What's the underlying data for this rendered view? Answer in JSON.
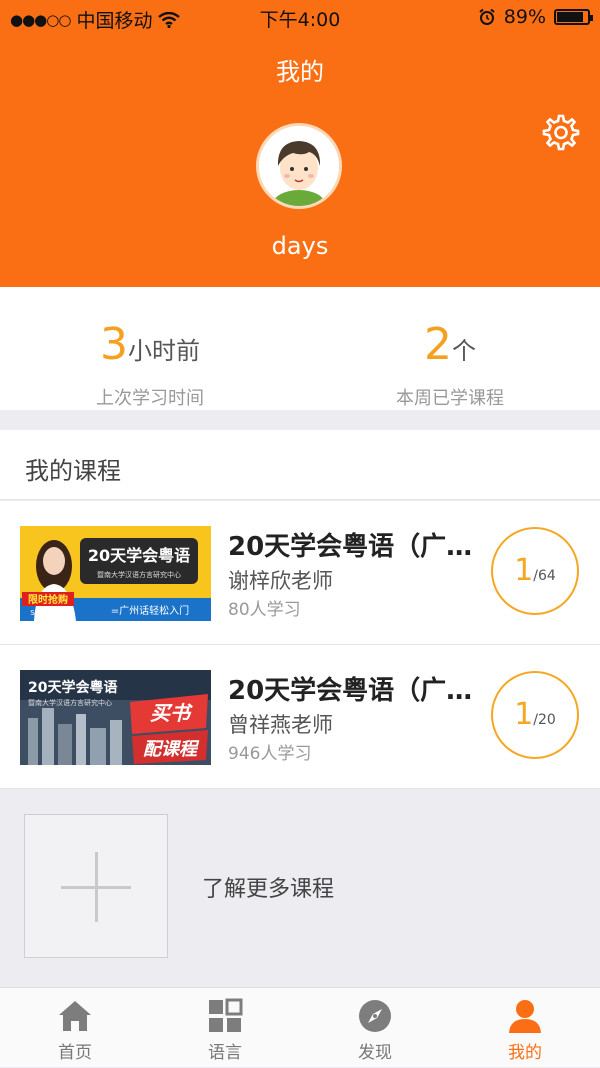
{
  "status_bar": {
    "carrier": "中国移动",
    "time": "下午4:00",
    "battery": "89%",
    "signal_dots": "●●●○○"
  },
  "header": {
    "title": "我的",
    "username": "days",
    "settings_icon": "gear-icon",
    "avatar_icon": "cartoon-avatar",
    "bg_color": "#fa6f14"
  },
  "stats": [
    {
      "value": "3",
      "unit": "小时前",
      "label": "上次学习时间"
    },
    {
      "value": "2",
      "unit": "个",
      "label": "本周已学课程"
    }
  ],
  "my_courses": {
    "heading": "我的课程",
    "items": [
      {
        "title": "20天学会粤语（广…",
        "teacher": "谢梓欣老师",
        "learners": "80人学习",
        "progress_current": "1",
        "progress_total": "/64",
        "thumb_title": "20天学会粤语",
        "thumb_subtitle": "暨南大学汉语方言研究中心",
        "thumb_tag": "限时抢购",
        "thumb_sale": "SALE 50%",
        "thumb_caption": "=广州话轻松入门"
      },
      {
        "title": "20天学会粤语（广…",
        "teacher": "曾祥燕老师",
        "learners": "946人学习",
        "progress_current": "1",
        "progress_total": "/20",
        "thumb_title": "20天学会粤语",
        "thumb_subtitle": "暨南大学汉语方言研究中心",
        "thumb_tag": "买书",
        "thumb_tag2": "配课程"
      }
    ]
  },
  "more_courses": {
    "label": "了解更多课程",
    "icon": "plus-icon"
  },
  "tabbar": {
    "items": [
      {
        "label": "首页",
        "icon": "home-icon",
        "active": false
      },
      {
        "label": "语言",
        "icon": "grid-icon",
        "active": false
      },
      {
        "label": "发现",
        "icon": "compass-icon",
        "active": false
      },
      {
        "label": "我的",
        "icon": "person-icon",
        "active": true
      }
    ]
  },
  "colors": {
    "accent": "#fa6f14",
    "progress": "#f5a623",
    "stat_number": "#f5a020"
  }
}
